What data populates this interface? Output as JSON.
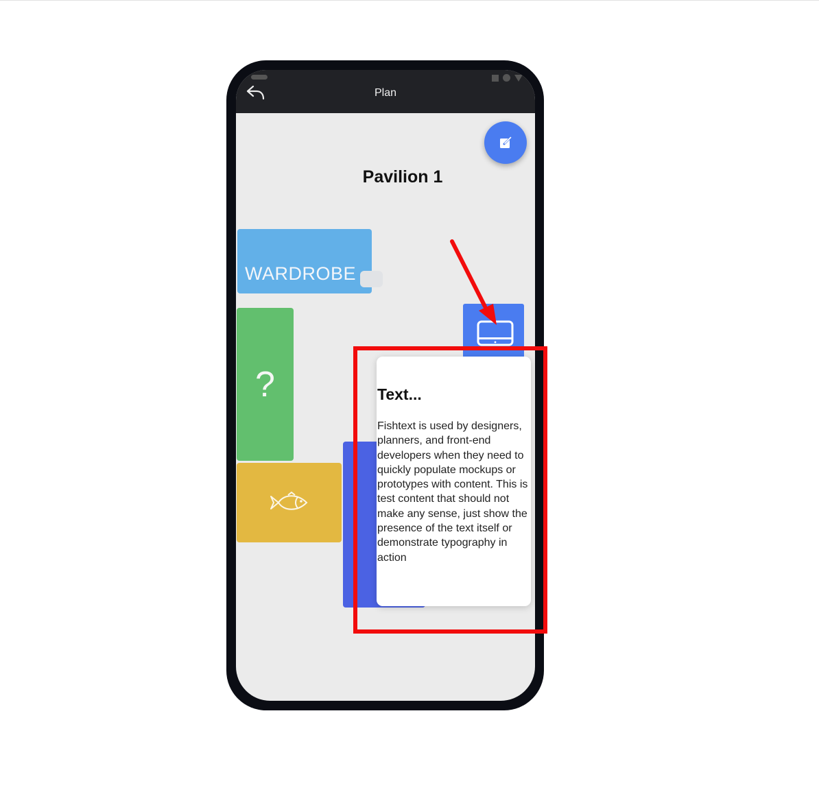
{
  "app_bar": {
    "title": "Plan",
    "back_icon": "reply-arrow-icon"
  },
  "page": {
    "title": "Pavilion 1"
  },
  "fab": {
    "icon": "edit-note-icon",
    "color": "#4a7cf0"
  },
  "blocks": {
    "wardrobe": {
      "label": "WARDROBE",
      "color": "#62b0e8"
    },
    "unknown": {
      "label": "?",
      "color": "#62bf6e"
    },
    "fish": {
      "icon": "fish-icon",
      "color": "#e3b841"
    },
    "tv": {
      "icon": "monitor-icon",
      "color": "#4a7cf0"
    },
    "purple": {
      "color": "#4b62e3"
    }
  },
  "tooltip": {
    "title": "Text...",
    "body": "Fishtext is used by designers, planners, and front-end developers when they need to quickly populate mockups or prototypes with content. This is test content that should not make any sense, just show the presence of the text itself or demonstrate typography in action"
  },
  "annotation": {
    "highlight_color": "#f20c0c"
  }
}
